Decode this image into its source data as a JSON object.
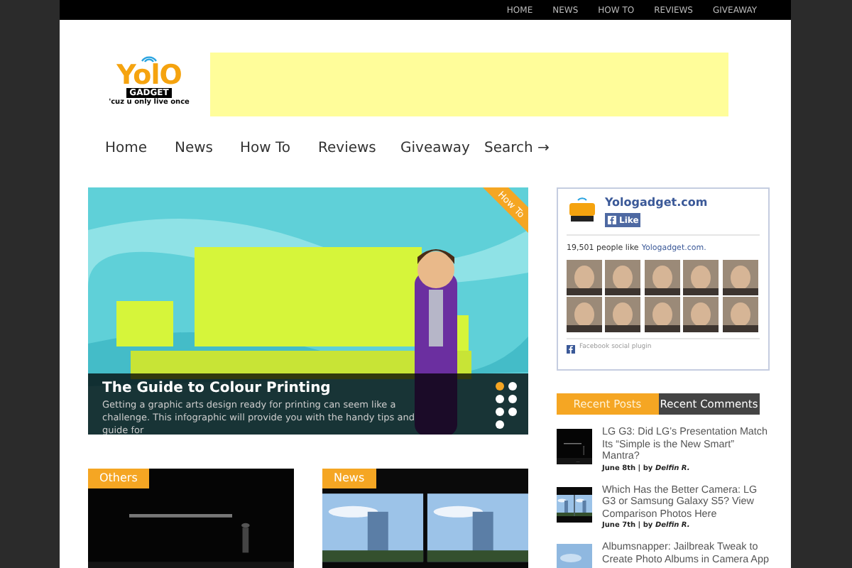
{
  "top_nav": [
    {
      "label": "HOME"
    },
    {
      "label": "NEWS"
    },
    {
      "label": "HOW TO"
    },
    {
      "label": "REVIEWS"
    },
    {
      "label": "GIVEAWAY"
    }
  ],
  "logo": {
    "name": "YolO",
    "brand": "GADGET",
    "tagline": "'cuz u only live once"
  },
  "main_nav": [
    {
      "label": "Home"
    },
    {
      "label": "News"
    },
    {
      "label": "How To"
    },
    {
      "label": "Reviews"
    },
    {
      "label": "Giveaway"
    },
    {
      "label": "Search →"
    }
  ],
  "featured": {
    "ribbon": "How To",
    "title": "The Guide to Colour Printing",
    "excerpt": "Getting a graphic arts design ready for printing can seem like a challenge. This infographic will provide you with the handy tips and guide for",
    "slides": [
      {
        "selected": true
      },
      {
        "selected": false
      },
      {
        "selected": false
      },
      {
        "selected": false
      },
      {
        "selected": false
      },
      {
        "selected": false
      },
      {
        "selected": false
      }
    ]
  },
  "facebook_box": {
    "page_name": "Yologadget.com",
    "like_button": "Like",
    "count_text": "19,501 people like",
    "count_link": "Yologadget.com.",
    "footer": "Facebook social plugin"
  },
  "sidebar_tabs": [
    {
      "label": "Recent Posts",
      "selected": true
    },
    {
      "label": "Recent Comments",
      "selected": false
    }
  ],
  "recent_posts": [
    {
      "title": "LG G3: Did LG’s Presentation Match Its “Simple is the New Smart” Mantra?",
      "meta": "June 8th | by *Delfin R.*"
    },
    {
      "title": "Which Has the Better Camera: LG G3 or Samsung Galaxy S5? View Comparison Photos Here",
      "meta": "June 7th | by *Delfin R.*"
    },
    {
      "title": "Albumsnapper: Jailbreak Tweak to Create Photo Albums in Camera App"
    }
  ],
  "category_cards": [
    {
      "category": "Others"
    },
    {
      "category": "News"
    }
  ]
}
